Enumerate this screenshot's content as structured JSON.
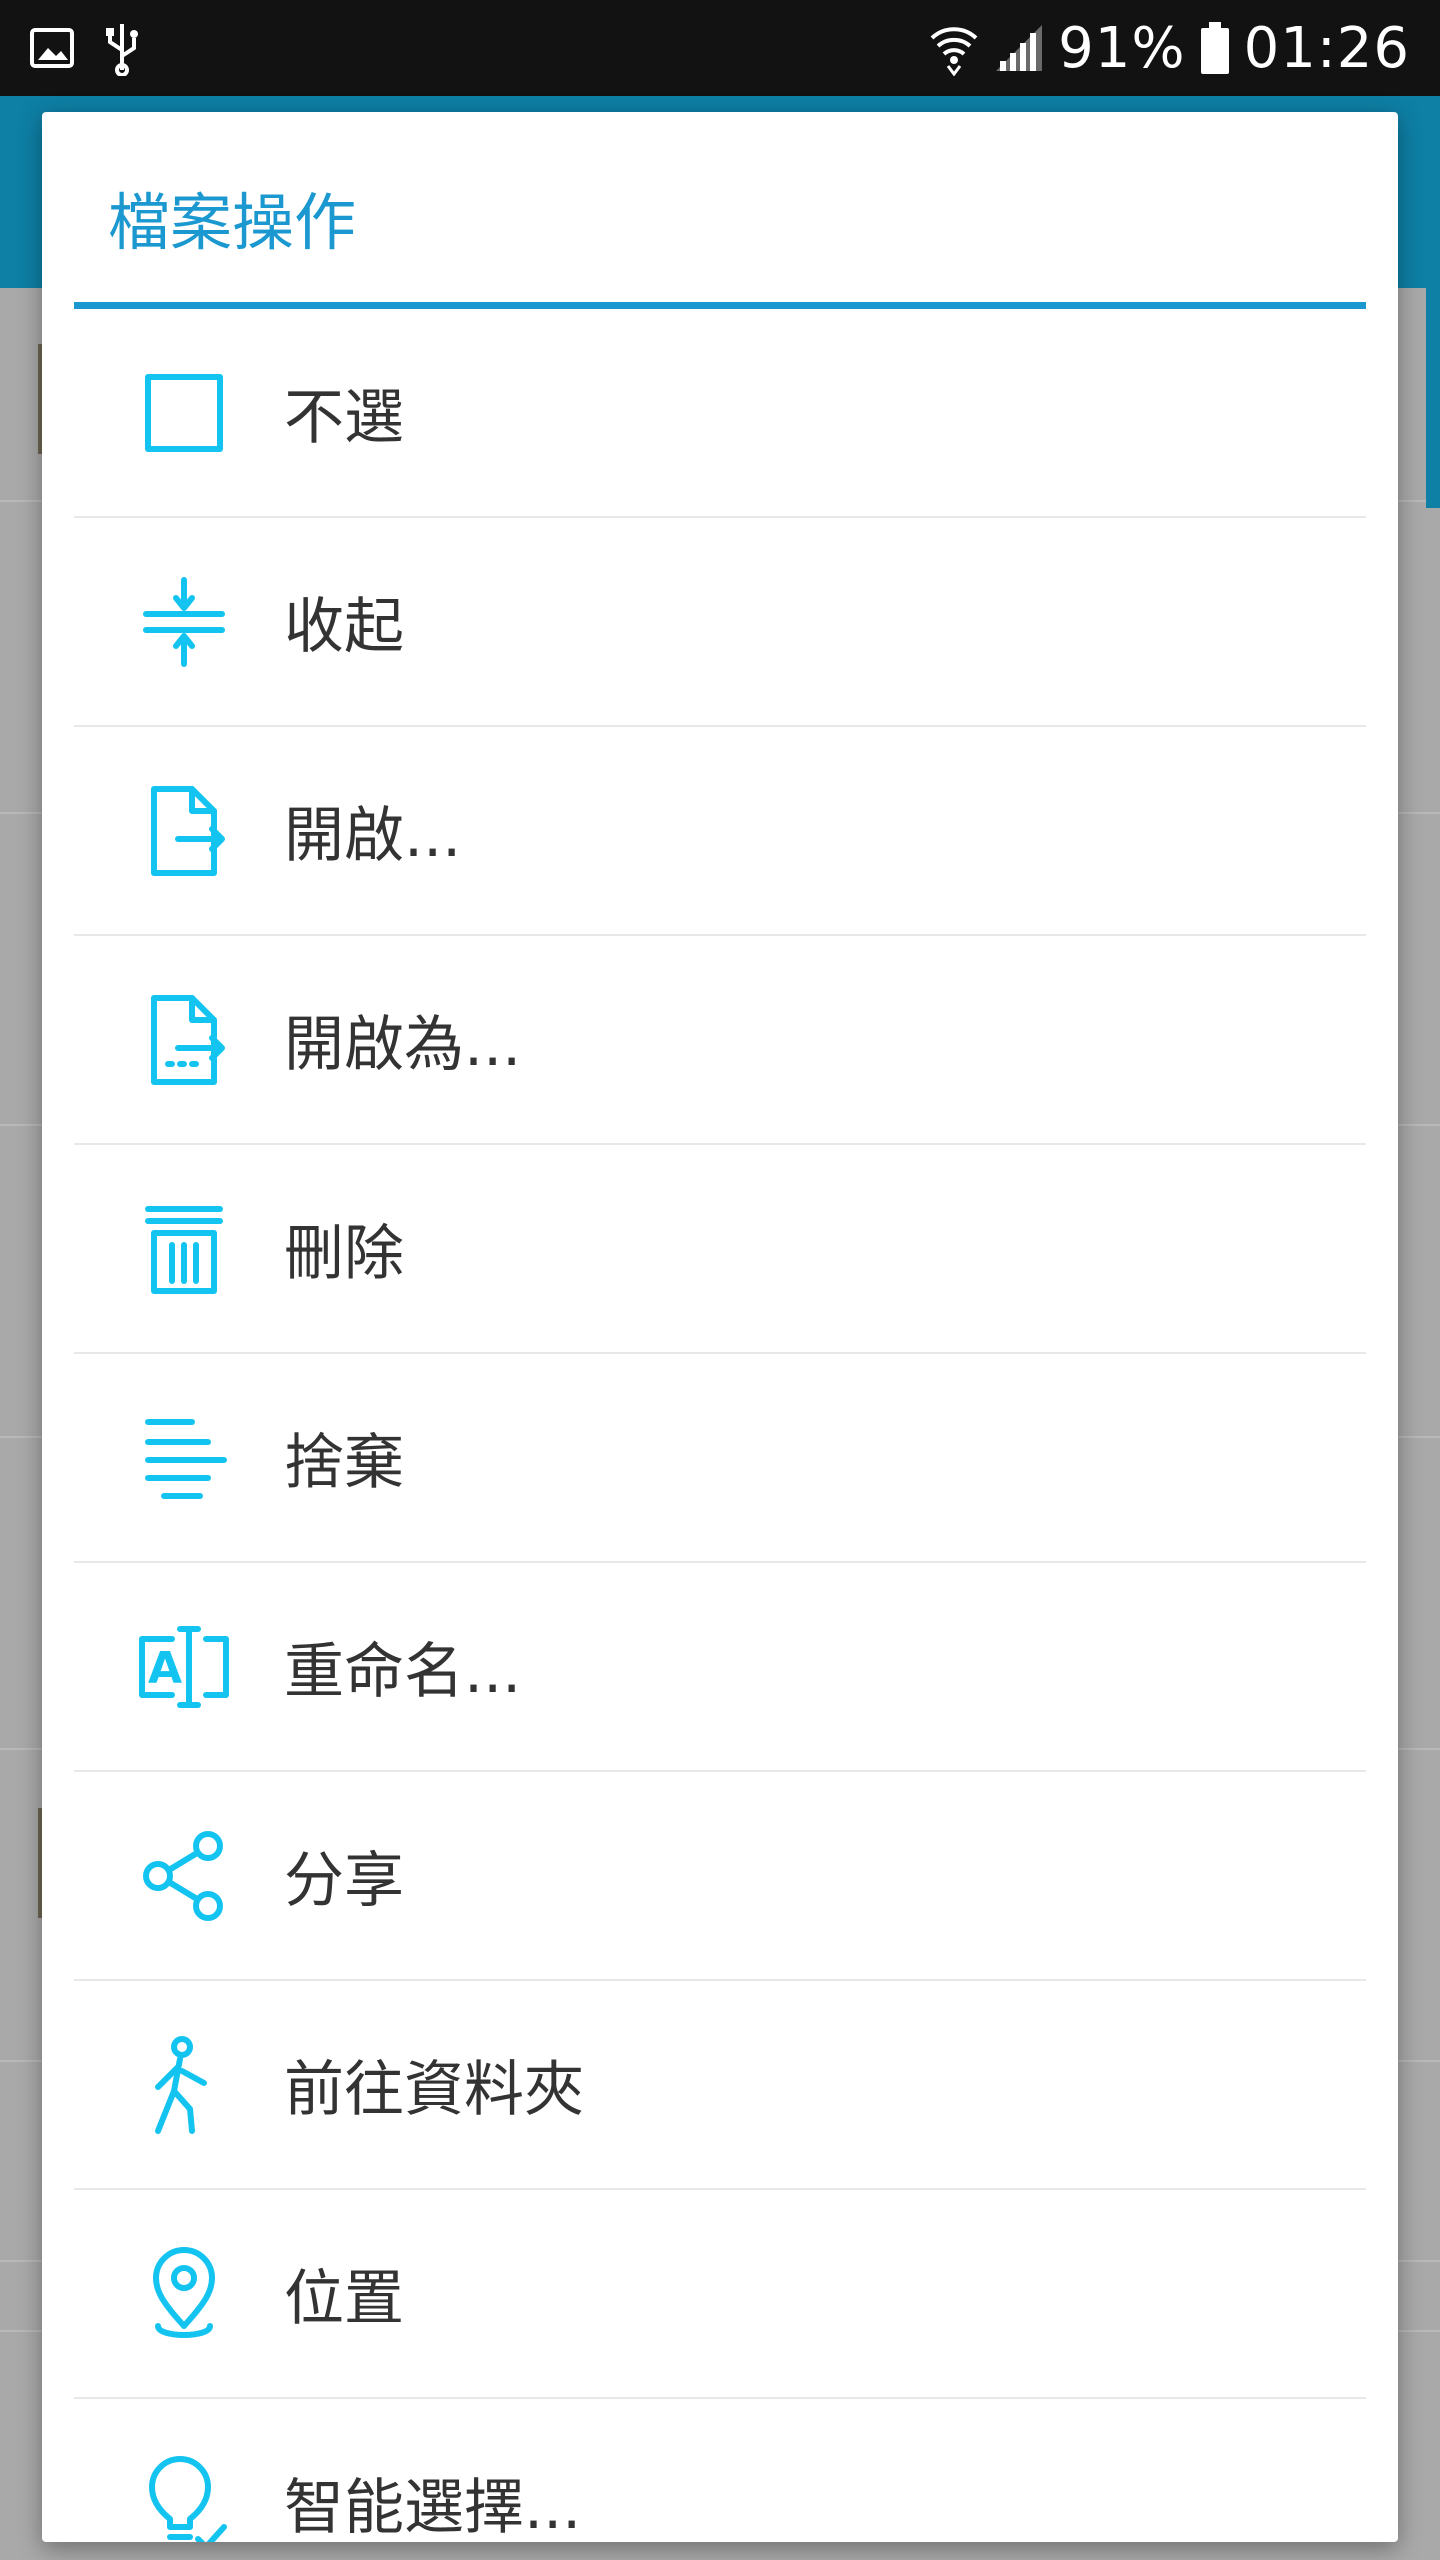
{
  "status_bar": {
    "battery_percent": "91%",
    "time": "01:26",
    "icons": [
      "image-icon",
      "usb-icon",
      "wifi-icon",
      "signal-icon",
      "battery-icon"
    ]
  },
  "dialog": {
    "title": "檔案操作",
    "accent_color": "#1a98cf",
    "icon_color": "#14c4f0",
    "items": [
      {
        "label": "不選",
        "icon": "checkbox-unchecked-icon"
      },
      {
        "label": "收起",
        "icon": "collapse-icon"
      },
      {
        "label": "開啟...",
        "icon": "open-file-icon"
      },
      {
        "label": "開啟為...",
        "icon": "open-as-file-icon"
      },
      {
        "label": "刪除",
        "icon": "trash-icon"
      },
      {
        "label": "捨棄",
        "icon": "discard-lines-icon"
      },
      {
        "label": "重命名...",
        "icon": "rename-icon"
      },
      {
        "label": "分享",
        "icon": "share-icon"
      },
      {
        "label": "前往資料夾",
        "icon": "walk-to-folder-icon"
      },
      {
        "label": "位置",
        "icon": "location-pin-icon"
      },
      {
        "label": "智能選擇...",
        "icon": "lightbulb-icon"
      }
    ]
  }
}
